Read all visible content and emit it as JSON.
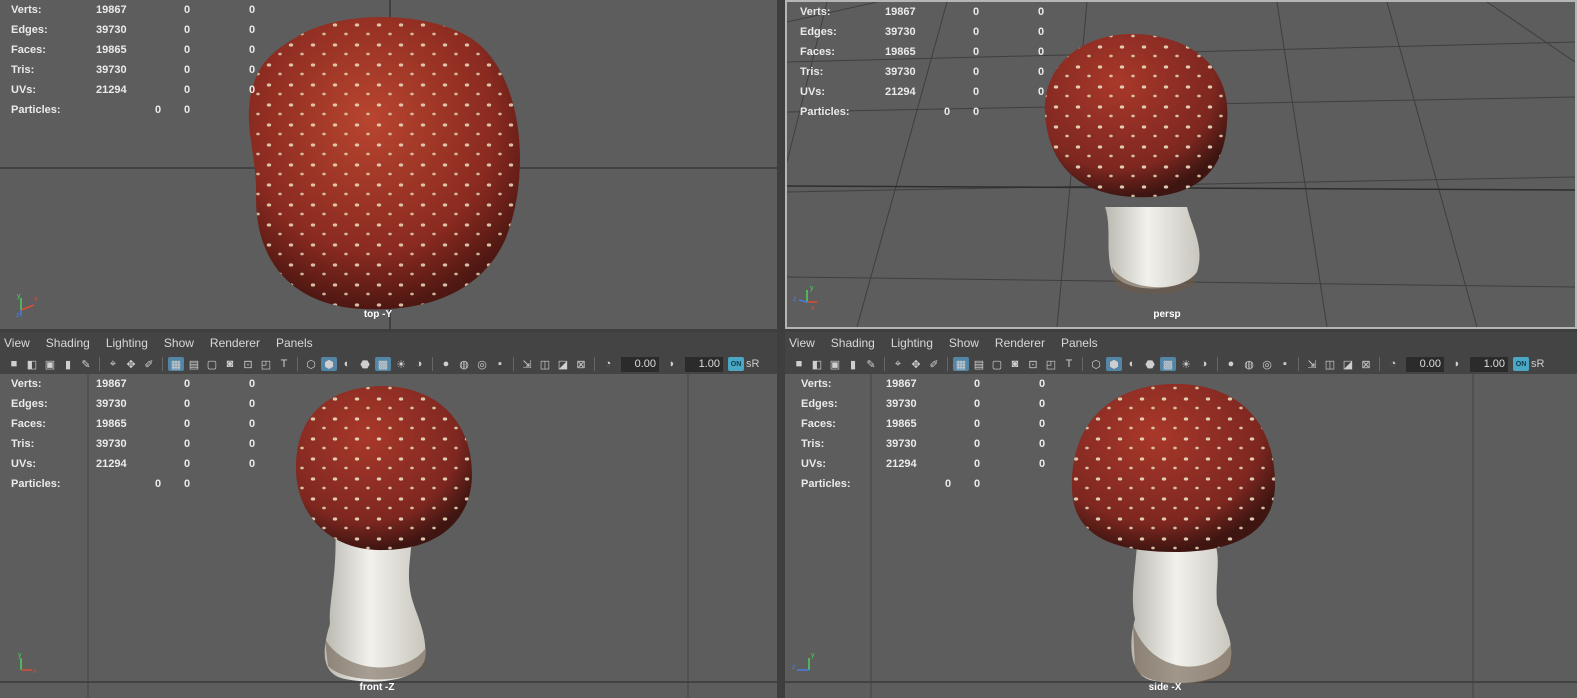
{
  "stats_labels": {
    "verts": "Verts:",
    "edges": "Edges:",
    "faces": "Faces:",
    "tris": "Tris:",
    "uvs": "UVs:",
    "particles": "Particles:"
  },
  "stats_values": {
    "verts": [
      "19867",
      "0",
      "0"
    ],
    "edges": [
      "39730",
      "0",
      "0"
    ],
    "faces": [
      "19865",
      "0",
      "0"
    ],
    "tris": [
      "39730",
      "0",
      "0"
    ],
    "uvs": [
      "21294",
      "0",
      "0"
    ],
    "particles": [
      "0",
      "0"
    ]
  },
  "viewports": {
    "top": {
      "camera_label": "top -Y"
    },
    "persp": {
      "camera_label": "persp"
    },
    "front": {
      "camera_label": "front -Z"
    },
    "side": {
      "camera_label": "side -X"
    }
  },
  "menu": {
    "view": "View",
    "shading": "Shading",
    "lighting": "Lighting",
    "show": "Show",
    "renderer": "Renderer",
    "panels": "Panels"
  },
  "toolbar": {
    "exposure_value": "0.00",
    "gamma_value": "1.00",
    "color_mgmt_badge": "ON",
    "color_space": "sR"
  },
  "axis_labels": {
    "x": "x",
    "y": "y",
    "z": "z"
  },
  "colors": {
    "viewport_bg": "#5d5d5d",
    "cap_red": "#8e2a22",
    "stem_white": "#e8e6df",
    "active_blue": "#5285a6"
  }
}
